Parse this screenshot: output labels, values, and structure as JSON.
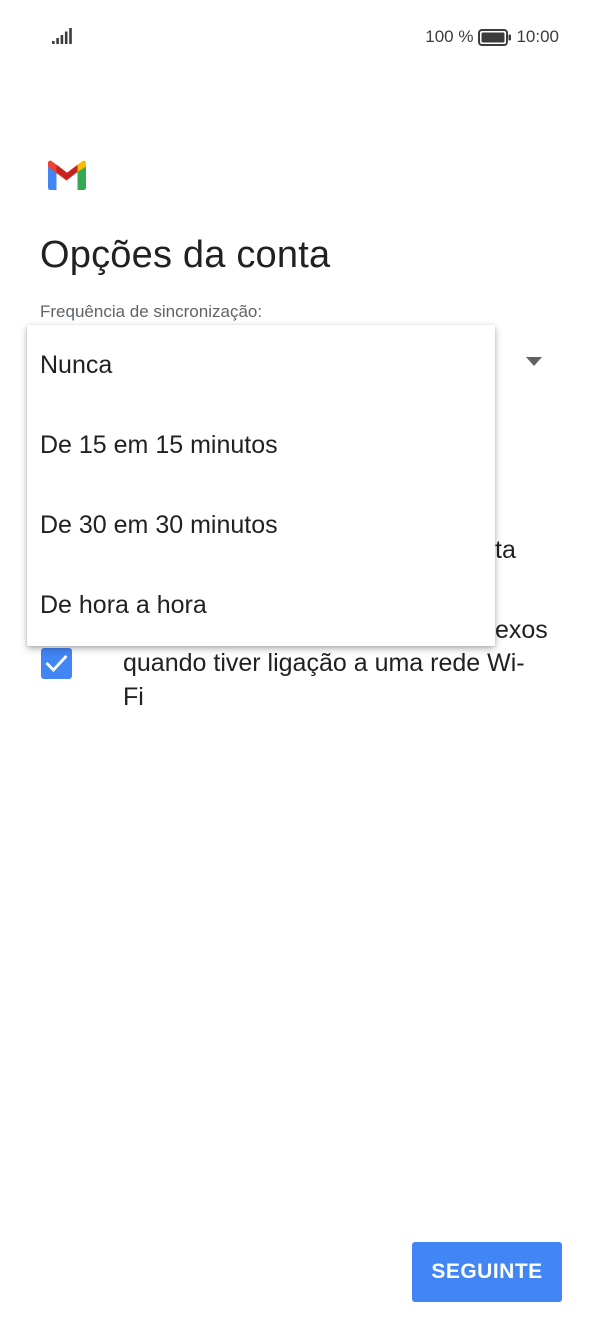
{
  "status_bar": {
    "signal_icon": "cellular-signal-icon",
    "battery_percent": "100 %",
    "battery_icon": "battery-full-icon",
    "time": "10:00"
  },
  "header": {
    "logo": "gmail-logo",
    "title": "Opções da conta"
  },
  "sync": {
    "label": "Frequência de sincronização:",
    "dropdown_icon": "dropdown-arrow-icon",
    "options": [
      "Nunca",
      "De 15 em 15 minutos",
      "De 30 em 30 minutos",
      "De hora a hora"
    ]
  },
  "background": {
    "partial_text_1": "ta",
    "partial_text_2": "exos"
  },
  "wifi_option": {
    "checked": true,
    "label": "quando tiver ligação a uma rede Wi-Fi"
  },
  "footer": {
    "next_label": "SEGUINTE"
  },
  "colors": {
    "accent": "#4285f4",
    "text": "#202124",
    "secondary_text": "#5f6368"
  }
}
